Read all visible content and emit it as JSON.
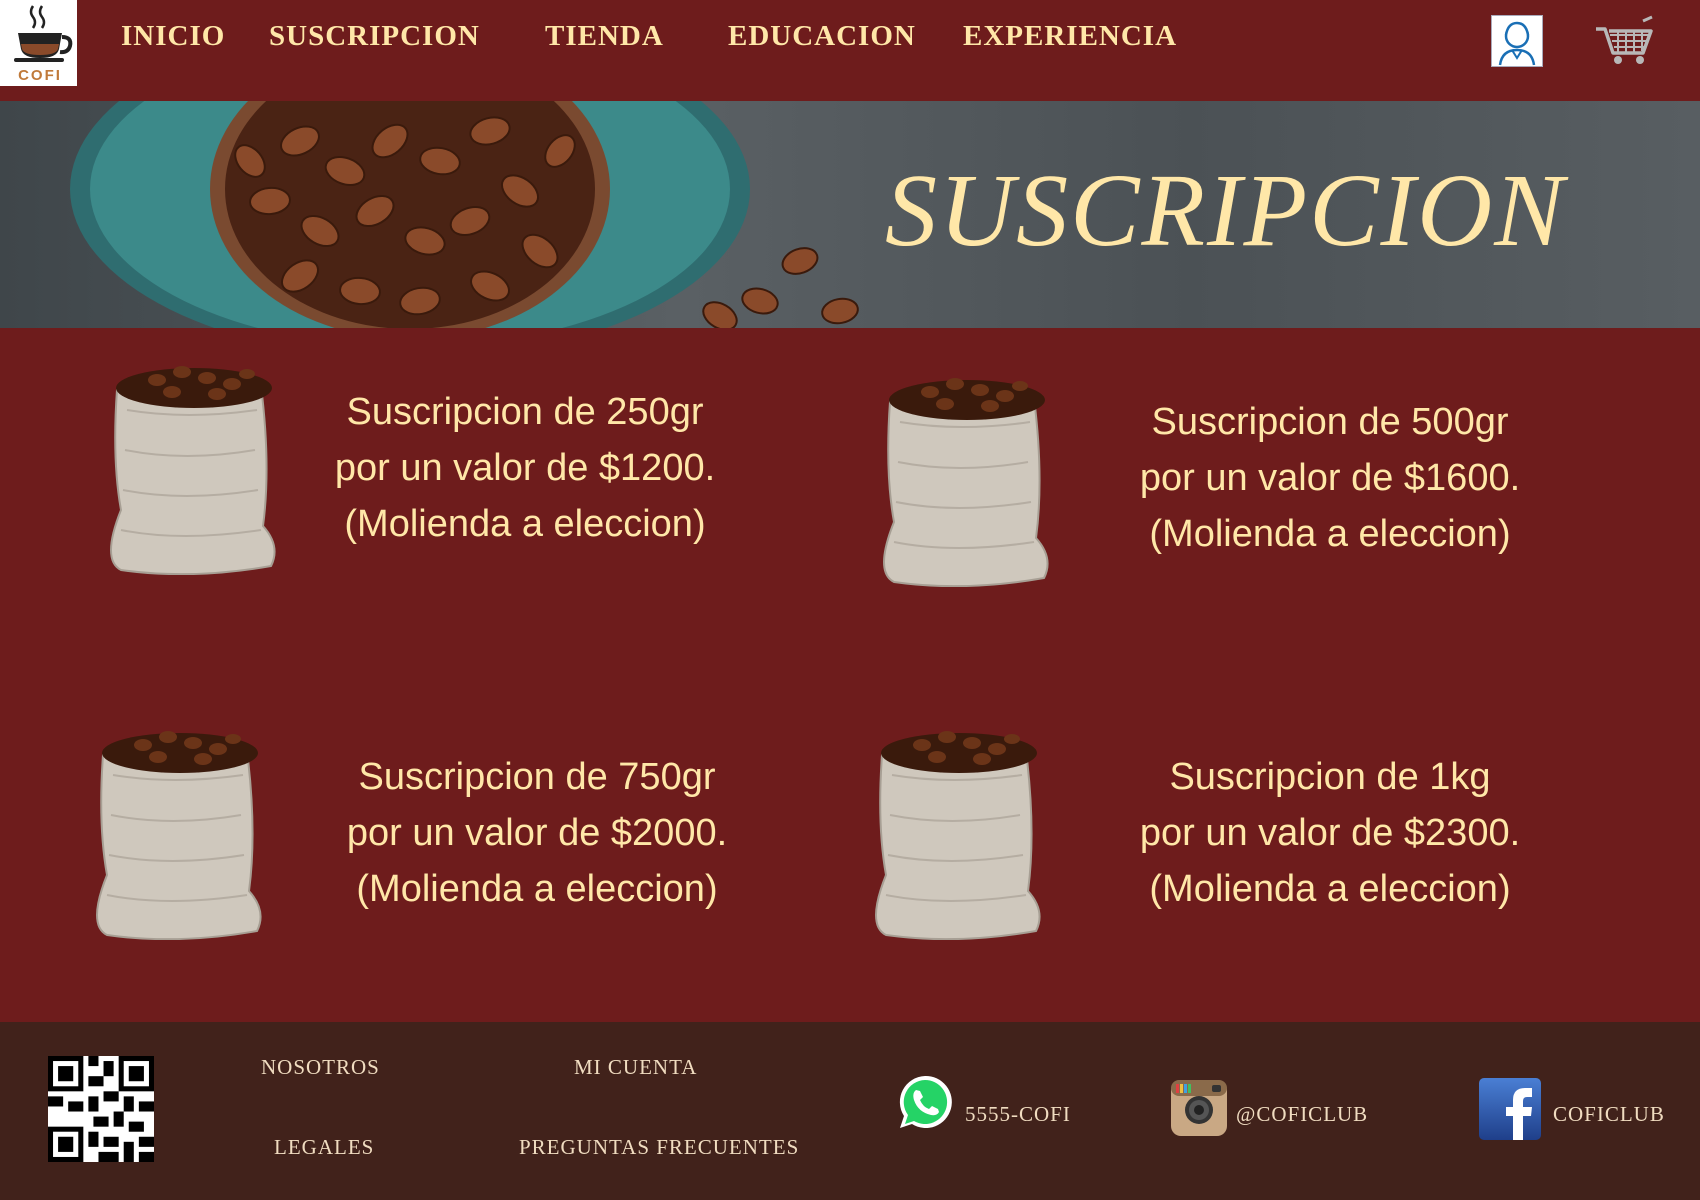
{
  "brand": {
    "logo_text": "COFI"
  },
  "nav": {
    "items": [
      "INICIO",
      "SUSCRIPCION",
      "TIENDA",
      "EDUCACION",
      "EXPERIENCIA"
    ]
  },
  "hero": {
    "title": "SUSCRIPCION"
  },
  "products": [
    {
      "line1": "Suscripcion de 250gr",
      "line2": "por un valor de $1200.",
      "line3": "(Molienda a eleccion)"
    },
    {
      "line1": "Suscripcion de 500gr",
      "line2": "por un valor de $1600.",
      "line3": "(Molienda a eleccion)"
    },
    {
      "line1": "Suscripcion de 750gr",
      "line2": "por un valor de $2000.",
      "line3": "(Molienda a eleccion)"
    },
    {
      "line1": "Suscripcion de 1kg",
      "line2": "por un valor de $2300.",
      "line3": "(Molienda a eleccion)"
    }
  ],
  "footer": {
    "links": [
      "NOSOTROS",
      "MI CUENTA",
      "LEGALES",
      "PREGUNTAS FRECUENTES"
    ],
    "whatsapp": "5555-COFI",
    "instagram": "@COFICLUB",
    "facebook": "COFICLUB"
  },
  "colors": {
    "background": "#6e1c1c",
    "accent_text": "#ffe7a8",
    "footer_bg": "#41221b"
  },
  "icons": [
    "coffee-cup-logo-icon",
    "user-profile-icon",
    "shopping-cart-icon",
    "qr-code-icon",
    "whatsapp-icon",
    "instagram-icon",
    "facebook-icon",
    "coffee-sack-icon"
  ]
}
